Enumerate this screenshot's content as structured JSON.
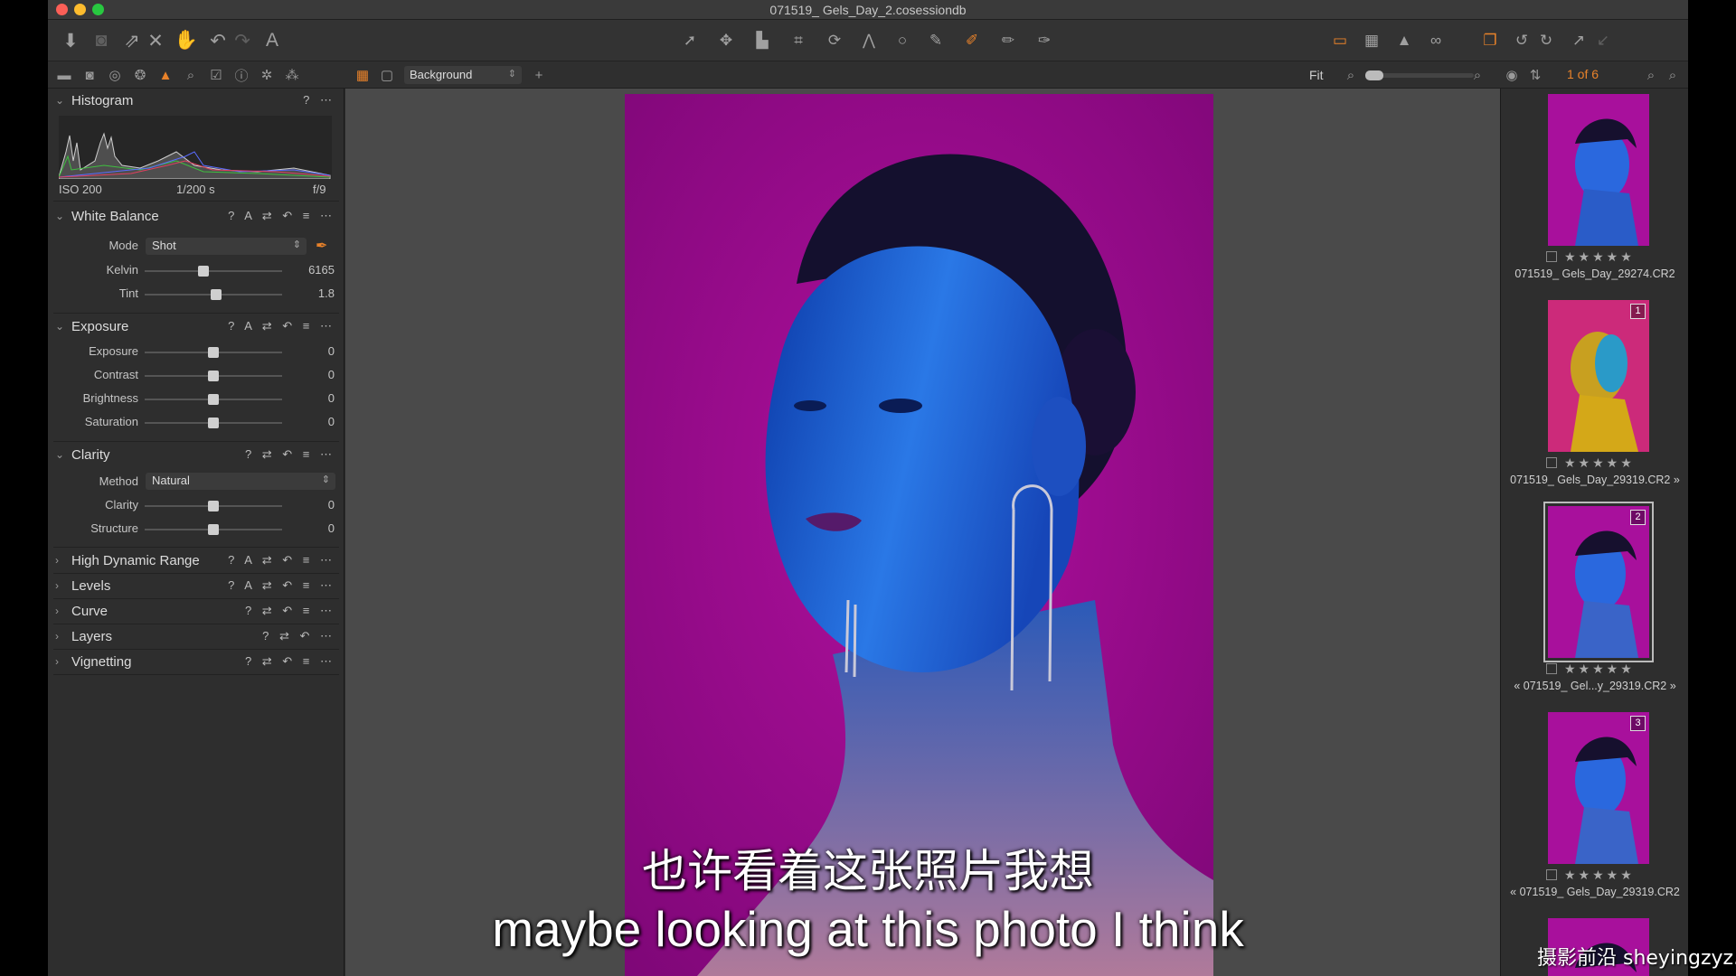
{
  "window": {
    "title": "071519_ Gels_Day_2.cosessiondb"
  },
  "toolbar": {
    "left_icons": [
      "import-icon",
      "camera-icon",
      "export-icon",
      "delete-icon",
      "hand-icon",
      "undo-icon",
      "redo-icon",
      "text-icon"
    ],
    "center_icons": [
      "cursor-icon",
      "pan-icon",
      "loupe-icon",
      "crop-icon",
      "rotate-icon",
      "keystone-icon",
      "circle-icon",
      "brush-icon",
      "draw-mask-icon",
      "erase-icon",
      "gradient-icon"
    ],
    "right_icons": [
      "overlay-icon",
      "grid-icon",
      "warning-icon",
      "glasses-icon",
      "stack-icon",
      "rotate-left-icon",
      "rotate-right-icon",
      "pick-icon",
      "apply-icon"
    ]
  },
  "subbar": {
    "layer": "Background",
    "fit": "Fit",
    "counter": "1 of 6"
  },
  "histogram": {
    "title": "Histogram",
    "iso": "ISO 200",
    "shutter": "1/200 s",
    "aperture": "f/9",
    "help": "?"
  },
  "white_balance": {
    "title": "White Balance",
    "actions": "? A ⇄ ↶ ≡ ⋯",
    "mode_label": "Mode",
    "mode_value": "Shot",
    "kelvin_label": "Kelvin",
    "kelvin_value": "6165",
    "kelvin_level": 0.42,
    "tint_label": "Tint",
    "tint_value": "1.8",
    "tint_level": 0.52
  },
  "exposure": {
    "title": "Exposure",
    "actions": "? A ⇄ ↶ ≡ ⋯",
    "rows": [
      {
        "label": "Exposure",
        "value": "0"
      },
      {
        "label": "Contrast",
        "value": "0"
      },
      {
        "label": "Brightness",
        "value": "0"
      },
      {
        "label": "Saturation",
        "value": "0"
      }
    ]
  },
  "clarity": {
    "title": "Clarity",
    "actions": "? ⇄ ↶ ≡ ⋯",
    "method_label": "Method",
    "method_value": "Natural",
    "clarity_label": "Clarity",
    "clarity_value": "0",
    "structure_label": "Structure",
    "structure_value": "0"
  },
  "collapsed_sections": [
    {
      "title": "High Dynamic Range",
      "actions": "? A ⇄ ↶ ≡ ⋯"
    },
    {
      "title": "Levels",
      "actions": "? A ⇄ ↶ ≡ ⋯"
    },
    {
      "title": "Curve",
      "actions": "? ⇄ ↶ ≡ ⋯"
    },
    {
      "title": "Layers",
      "actions": "? ⇄ ↶ ⋯"
    },
    {
      "title": "Vignetting",
      "actions": "? ⇄ ↶ ≡ ⋯"
    }
  ],
  "browser": {
    "stars": "★★★★★",
    "items": [
      {
        "name": "071519_ Gels_Day_29274.CR2",
        "badge": "",
        "style": "blue"
      },
      {
        "name": "071519_ Gels_Day_29319.CR2",
        "badge": "1",
        "style": "yellow",
        "suffix": "»"
      },
      {
        "name": "071519_ Gel...y_29319.CR2",
        "badge": "2",
        "style": "blue",
        "prefix": "«",
        "suffix": "»"
      },
      {
        "name": "071519_ Gels_Day_29319.CR2",
        "badge": "3",
        "style": "blue",
        "prefix": "«"
      }
    ]
  },
  "subtitles": {
    "chinese": "也许看着这张照片我想",
    "english": "maybe looking at this photo I think"
  },
  "watermark": "摄影前沿 sheyingzyz.com",
  "colors": {
    "accent": "#e8822a",
    "magenta": "#a0089c",
    "blue_light": "#1f6fe0"
  }
}
